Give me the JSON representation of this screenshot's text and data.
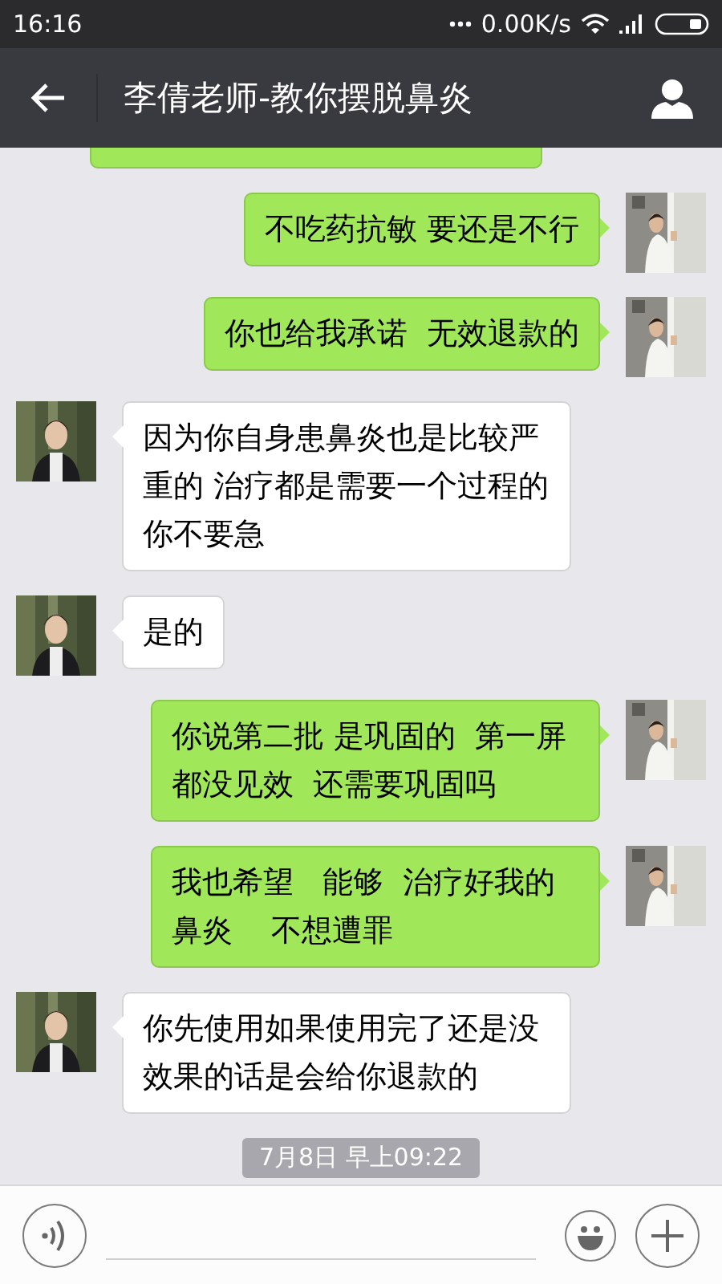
{
  "status_bar": {
    "time": "16:16",
    "speed": "0.00K/s"
  },
  "header": {
    "title": "李倩老师-教你摆脱鼻炎"
  },
  "messages": [
    {
      "kind": "cut"
    },
    {
      "kind": "sent",
      "text": "不吃药抗敏 要还是不行"
    },
    {
      "kind": "sent",
      "text": "你也给我承诺  无效退款的"
    },
    {
      "kind": "received",
      "text": "因为你自身患鼻炎也是比较严重的 治疗都是需要一个过程的你不要急"
    },
    {
      "kind": "received",
      "text": "是的"
    },
    {
      "kind": "sent",
      "text": "你说第二批 是巩固的  第一屏都没见效  还需要巩固吗"
    },
    {
      "kind": "sent",
      "text": "我也希望   能够  治疗好我的鼻炎    不想遭罪"
    },
    {
      "kind": "received",
      "text": "你先使用如果使用完了还是没效果的话是会给你退款的"
    },
    {
      "kind": "time",
      "text": "7月8日 早上09:22"
    }
  ]
}
